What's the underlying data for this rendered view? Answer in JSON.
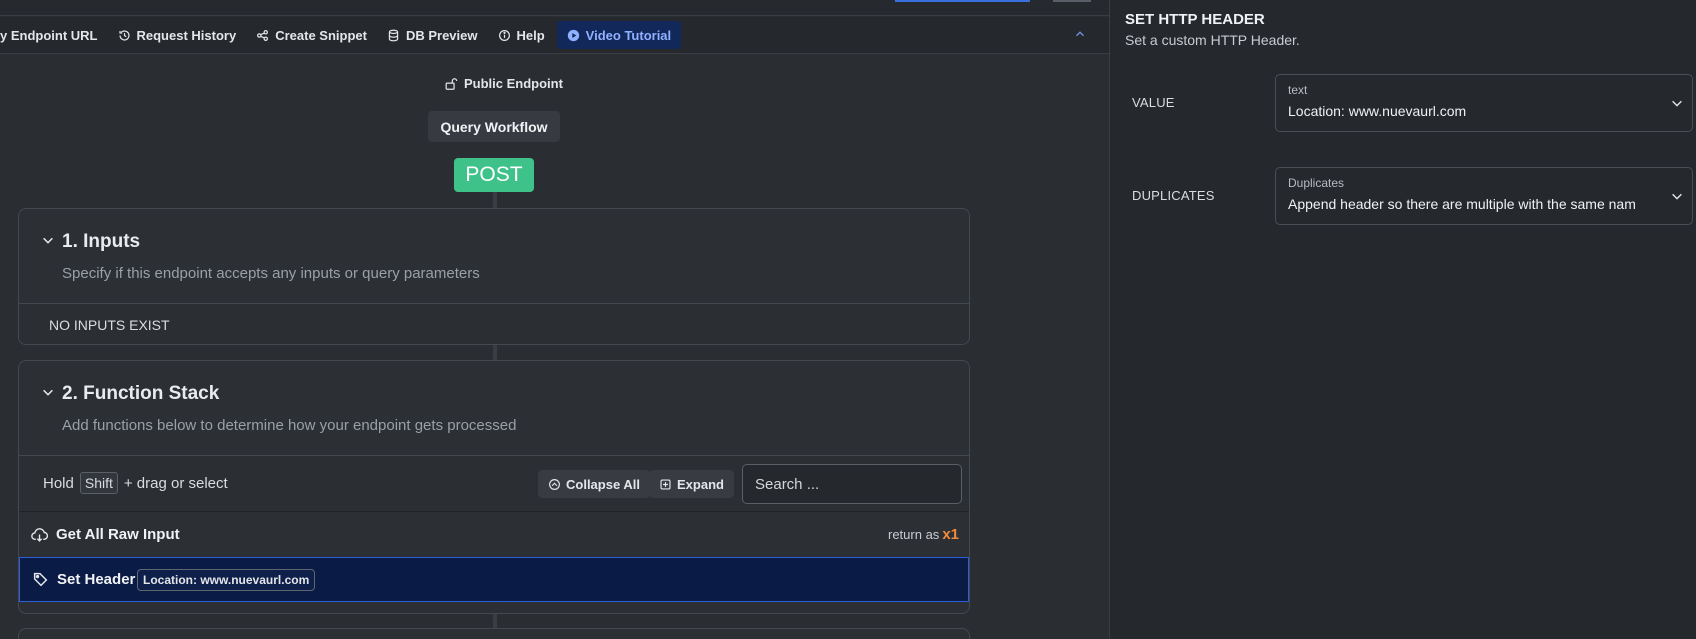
{
  "toolbar": {
    "items": [
      {
        "label": "y Endpoint URL",
        "icon": "copy-link-icon"
      },
      {
        "label": "Request History",
        "icon": "history-icon"
      },
      {
        "label": "Create Snippet",
        "icon": "share-icon"
      },
      {
        "label": "DB Preview",
        "icon": "database-icon"
      },
      {
        "label": "Help",
        "icon": "info-icon"
      },
      {
        "label": "Video Tutorial",
        "icon": "play-icon"
      }
    ]
  },
  "endpoint": {
    "visibility": "Public Endpoint",
    "workflow_button": "Query Workflow",
    "method": "POST"
  },
  "inputs_card": {
    "title": "1. Inputs",
    "subtitle": "Specify if this endpoint accepts any inputs or query parameters",
    "empty_text": "NO INPUTS EXIST"
  },
  "stack_card": {
    "title": "2. Function Stack",
    "subtitle": "Add functions below to determine how your endpoint gets processed",
    "hold_prefix": "Hold",
    "hold_key": "Shift",
    "hold_suffix": "+ drag or select",
    "collapse_all": "Collapse All",
    "expand": "Expand",
    "search_placeholder": "Search ...",
    "functions": [
      {
        "name": "Get All Raw Input",
        "return_label": "return as",
        "return_value": "x1"
      },
      {
        "name": "Set Header",
        "tag": "Location: www.nuevaurl.com"
      }
    ]
  },
  "panel": {
    "title": "SET HTTP HEADER",
    "subtitle": "Set a custom HTTP Header.",
    "value_label": "VALUE",
    "value_caption": "text",
    "value_text": "Location: www.nuevaurl.com",
    "duplicates_label": "DUPLICATES",
    "duplicates_caption": "Duplicates",
    "duplicates_text": "Append header so there are multiple with the same nam"
  },
  "colors": {
    "method_post": "#3ec28a",
    "selected_row": "#0a1b45",
    "accent_blue": "#2d5fd6",
    "return_count": "#f08a3c"
  }
}
